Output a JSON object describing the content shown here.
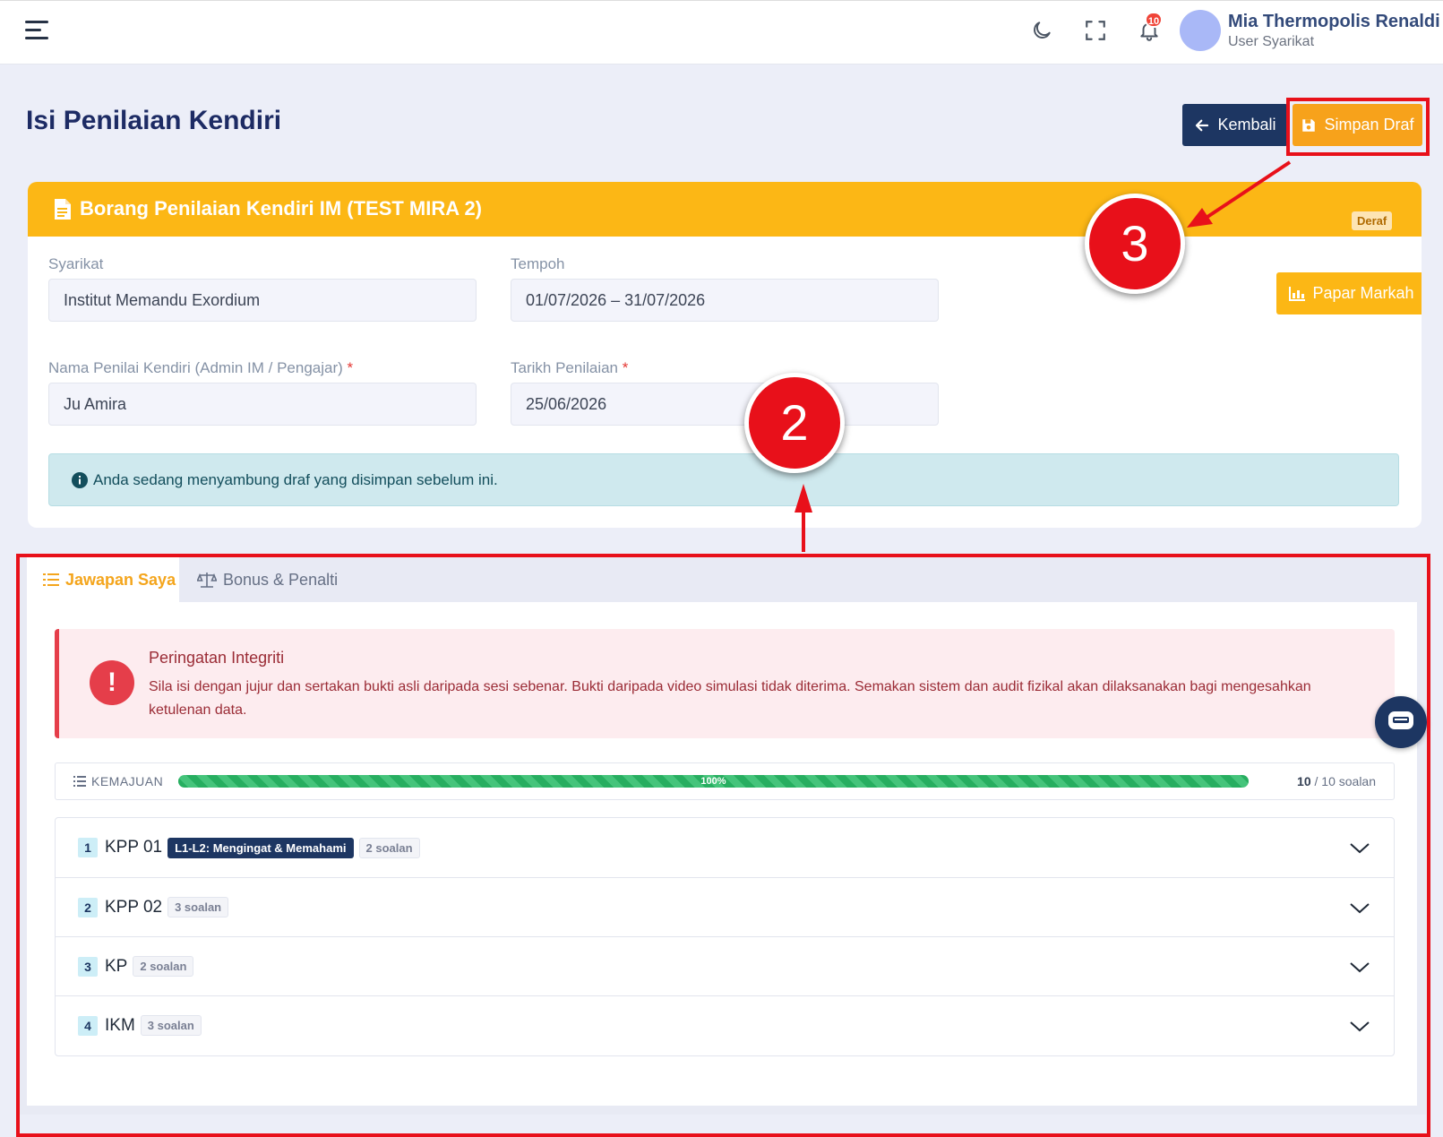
{
  "topbar": {
    "notification_count": "10",
    "user_name": "Mia Thermopolis Renaldi",
    "user_role": "User Syarikat"
  },
  "page": {
    "title": "Isi Penilaian Kendiri",
    "back_label": "Kembali",
    "save_draft_label": "Simpan Draf"
  },
  "form_card": {
    "title": "Borang Penilaian Kendiri IM (TEST MIRA 2)",
    "status_badge": "Deraf",
    "view_marks_label": "Papar Markah",
    "fields": {
      "syarikat_label": "Syarikat",
      "syarikat_value": "Institut Memandu Exordium",
      "tempoh_label": "Tempoh",
      "tempoh_value": "01/07/2026 – 31/07/2026",
      "penilai_label": "Nama Penilai Kendiri (Admin IM / Pengajar)",
      "penilai_value": "Ju Amira",
      "tarikh_label": "Tarikh Penilaian",
      "tarikh_value": "25/06/2026",
      "required_mark": "*"
    },
    "info_alert": "Anda sedang menyambung draf yang disimpan sebelum ini."
  },
  "tabs": [
    {
      "label": "Jawapan Saya",
      "active": true
    },
    {
      "label": "Bonus & Penalti",
      "active": false
    }
  ],
  "warning": {
    "icon_text": "!",
    "title": "Peringatan Integriti",
    "text": "Sila isi dengan jujur dan sertakan bukti asli daripada sesi sebenar. Bukti daripada video simulasi tidak diterima. Semakan sistem dan audit fizikal akan dilaksanakan bagi mengesahkan ketulenan data."
  },
  "progress": {
    "label": "KEMAJUAN",
    "percent_label": "100%",
    "fraction": 1.0,
    "answered": "10",
    "total_text": "/ 10 soalan"
  },
  "sections": [
    {
      "number": "1",
      "name": "KPP 01",
      "level": "L1-L2: Mengingat & Memahami",
      "count": "2 soalan"
    },
    {
      "number": "2",
      "name": "KPP 02",
      "level": "",
      "count": "3 soalan"
    },
    {
      "number": "3",
      "name": "KP",
      "level": "",
      "count": "2 soalan"
    },
    {
      "number": "4",
      "name": "IKM",
      "level": "",
      "count": "3 soalan"
    }
  ],
  "annotations": {
    "marker_2": "2",
    "marker_3": "3",
    "highlight_color": "#e8101a"
  },
  "colors": {
    "primary": "#1d3662",
    "accent": "#fcb715",
    "draft_button": "#f7a21b",
    "danger": "#e53e4a",
    "success": "#27ae60"
  }
}
